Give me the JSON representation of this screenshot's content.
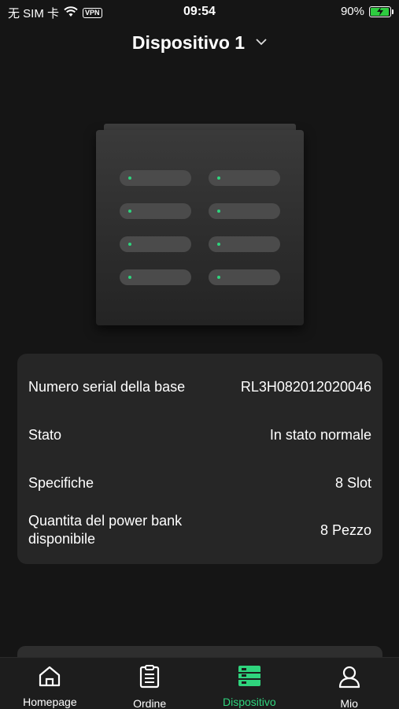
{
  "status_bar": {
    "carrier": "无 SIM 卡",
    "vpn": "VPN",
    "time": "09:54",
    "battery": "90%",
    "battery_level": 0.9
  },
  "header": {
    "title": "Dispositivo 1"
  },
  "info": [
    {
      "label": "Numero serial della base",
      "value": "RL3H082012020046"
    },
    {
      "label": "Stato",
      "value": "In stato normale"
    },
    {
      "label": "Specifiche",
      "value": "8 Slot"
    },
    {
      "label": "Quantita del power bank disponibile",
      "value": "8 Pezzo"
    }
  ],
  "tabs": [
    {
      "label": "Homepage",
      "icon": "home-icon"
    },
    {
      "label": "Ordine",
      "icon": "order-list-icon"
    },
    {
      "label": "Dispositivo",
      "icon": "device-icon",
      "active": true
    },
    {
      "label": "Mio",
      "icon": "user-icon"
    }
  ],
  "colors": {
    "accent": "#2fd47d",
    "background": "#151515",
    "card": "#262626"
  }
}
